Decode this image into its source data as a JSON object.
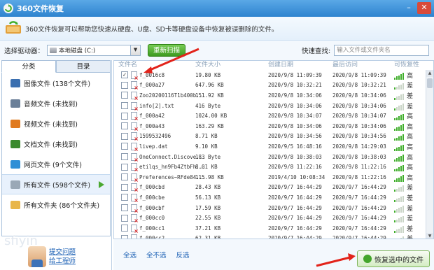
{
  "window": {
    "title": "360文件恢复"
  },
  "info": {
    "text": "360文件恢复可以帮助您快速从硬盘、U盘、SD卡等硬盘设备中恢复被误删除的文件。"
  },
  "toolbar": {
    "drive_label": "选择驱动器：",
    "drive_value": "本地磁盘 (C:)",
    "rescan_label": "重新扫描",
    "quick_search_label": "快速查找:",
    "search_placeholder": "输入文件或文件夹名"
  },
  "tabs": [
    {
      "label": "分类"
    },
    {
      "label": "目录"
    }
  ],
  "categories": [
    {
      "label": "图像文件 (138个文件)",
      "icon": "image-icon",
      "color": "#3a6fb0"
    },
    {
      "label": "音频文件 (未找到)",
      "icon": "music-icon",
      "color": "#6a7f98"
    },
    {
      "label": "视频文件 (未找到)",
      "icon": "video-icon",
      "color": "#e07a1f"
    },
    {
      "label": "文档文件 (未找到)",
      "icon": "document-icon",
      "color": "#3b8a2e"
    },
    {
      "label": "网页文件 (9个文件)",
      "icon": "web-icon",
      "color": "#2f8fd6"
    },
    {
      "label": "所有文件 (598个文件)",
      "icon": "file-icon",
      "color": "#9aa8b6"
    },
    {
      "label": "所有文件夹 (86个文件夹)",
      "icon": "folder-icon",
      "color": "#e8b64a"
    }
  ],
  "support": {
    "line1": "提交问题",
    "line2": "给工程师"
  },
  "table": {
    "headers": {
      "name": "文件名",
      "size": "文件大小",
      "created": "创建日期",
      "accessed": "最后访问",
      "recoverability": "可恢复性"
    },
    "rows": [
      {
        "checked": true,
        "name": "f_0016c8",
        "size": "19.80 KB",
        "created": "2020/9/8 11:09:39",
        "accessed": "2020/9/8 11:09:39",
        "rec": "高",
        "level": 5
      },
      {
        "checked": false,
        "name": "f_000a27",
        "size": "647.96 KB",
        "created": "2020/9/8 10:32:21",
        "accessed": "2020/9/8 10:32:21",
        "rec": "差",
        "level": 1
      },
      {
        "checked": false,
        "name": "Zoo20200116T1b400b...",
        "size": "151.92 KB",
        "created": "2020/9/8 10:34:06",
        "accessed": "2020/9/8 10:34:06",
        "rec": "差",
        "level": 1
      },
      {
        "checked": false,
        "name": "info[2].txt",
        "size": "416 Byte",
        "created": "2020/9/8 10:34:06",
        "accessed": "2020/9/8 10:34:06",
        "rec": "差",
        "level": 1
      },
      {
        "checked": false,
        "name": "f_000a42",
        "size": "1024.00 KB",
        "created": "2020/9/8 10:34:07",
        "accessed": "2020/9/8 10:34:07",
        "rec": "高",
        "level": 5
      },
      {
        "checked": false,
        "name": "f_000a43",
        "size": "163.29 KB",
        "created": "2020/9/8 10:34:06",
        "accessed": "2020/9/8 10:34:06",
        "rec": "高",
        "level": 5
      },
      {
        "checked": false,
        "name": "1599532496",
        "size": "8.71 KB",
        "created": "2020/9/8 10:34:56",
        "accessed": "2020/9/8 10:34:56",
        "rec": "高",
        "level": 5
      },
      {
        "checked": false,
        "name": "livep.dat",
        "size": "9.10 KB",
        "created": "2020/9/5 16:48:16",
        "accessed": "2020/9/8 14:29:03",
        "rec": "高",
        "level": 5
      },
      {
        "checked": false,
        "name": "OneConnect.Discove...",
        "size": "183 Byte",
        "created": "2020/9/8 10:38:03",
        "accessed": "2020/9/8 10:38:03",
        "rec": "高",
        "level": 5
      },
      {
        "checked": false,
        "name": "etilqs_hn9Fb4ZtbFh...",
        "size": "8.01 KB",
        "created": "2020/9/8 11:22:16",
        "accessed": "2020/9/8 11:22:16",
        "rec": "高",
        "level": 5
      },
      {
        "checked": false,
        "name": "Preferences~RFde84...",
        "size": "115.98 KB",
        "created": "2019/4/10 10:08:34",
        "accessed": "2020/9/8 11:22:16",
        "rec": "高",
        "level": 5
      },
      {
        "checked": false,
        "name": "f_000cbd",
        "size": "28.43 KB",
        "created": "2020/9/7 16:44:29",
        "accessed": "2020/9/7 16:44:29",
        "rec": "差",
        "level": 1
      },
      {
        "checked": false,
        "name": "f_000cbe",
        "size": "56.13 KB",
        "created": "2020/9/7 16:44:29",
        "accessed": "2020/9/7 16:44:29",
        "rec": "差",
        "level": 1
      },
      {
        "checked": false,
        "name": "f_000cbf",
        "size": "17.59 KB",
        "created": "2020/9/7 16:44:29",
        "accessed": "2020/9/7 16:44:29",
        "rec": "差",
        "level": 1
      },
      {
        "checked": false,
        "name": "f_000cc0",
        "size": "22.55 KB",
        "created": "2020/9/7 16:44:29",
        "accessed": "2020/9/7 16:44:29",
        "rec": "差",
        "level": 1
      },
      {
        "checked": false,
        "name": "f_000cc1",
        "size": "37.21 KB",
        "created": "2020/9/7 16:44:29",
        "accessed": "2020/9/7 16:44:29",
        "rec": "差",
        "level": 1
      },
      {
        "checked": false,
        "name": "f_000cc2",
        "size": "62.31 KB",
        "created": "2020/9/7 16:44:29",
        "accessed": "2020/9/7 16:44:29",
        "rec": "差",
        "level": 1
      }
    ]
  },
  "bottom": {
    "select_all": "全选",
    "select_none": "全不选",
    "invert": "反选",
    "recover_label": "恢复选中的文件"
  },
  "watermark": "sfiyin",
  "colors": {
    "accent": "#2e83cf",
    "good": "#3fae2a",
    "annotation": "#e2231a"
  }
}
